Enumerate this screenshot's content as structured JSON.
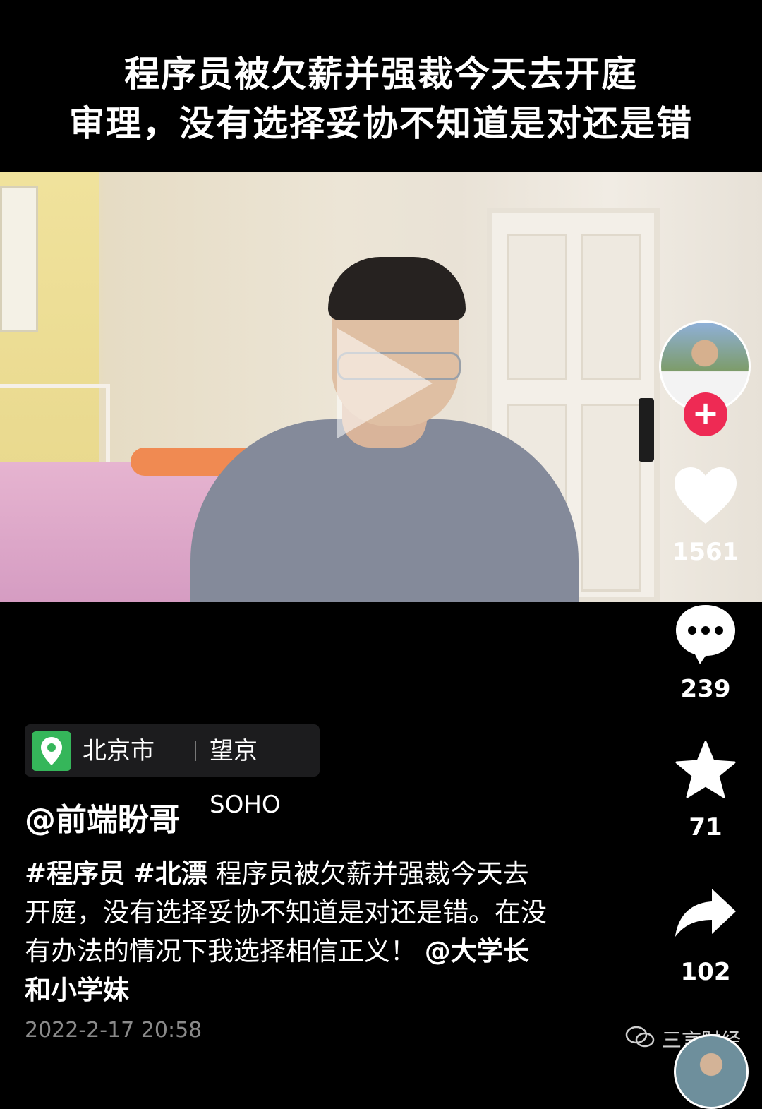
{
  "header": {
    "title_line1": "程序员被欠薪并强裁今天去开庭",
    "title_line2": "审理，没有选择妥协不知道是对还是错"
  },
  "actions": {
    "likes": "1561",
    "comments": "239",
    "favorites": "71",
    "shares": "102",
    "follow_symbol": "+"
  },
  "location": {
    "city": "北京市",
    "place": "望京SOHO"
  },
  "post": {
    "username": "@前端盼哥",
    "tag1": "#程序员",
    "tag2": "#北漂",
    "text": "程序员被欠薪并强裁今天去开庭，没有选择妥协不知道是对还是错。在没有办法的情况下我选择相信正义！",
    "mention": "@大学长和小学妹",
    "date": "2022-2-17 20:58"
  },
  "watermark": {
    "text": "三言财经"
  },
  "colors": {
    "follow_red": "#ee2a54",
    "location_green": "#35b65a"
  }
}
